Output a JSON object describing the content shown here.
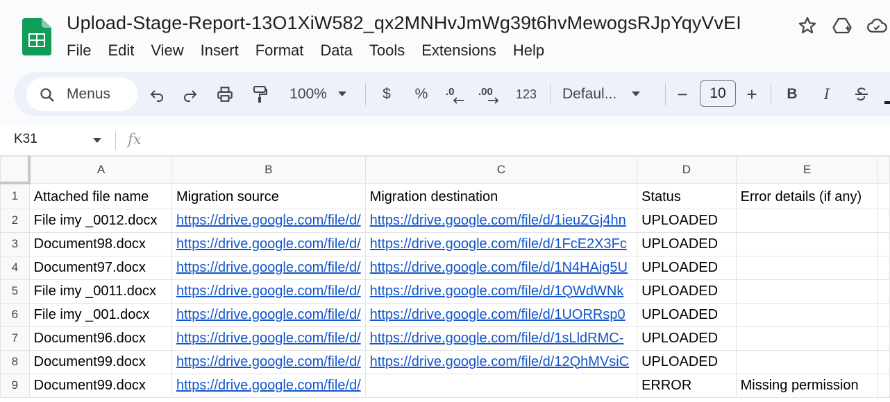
{
  "document": {
    "title": "Upload-Stage-Report-13O1XiW582_qx2MNHvJmWg39t6hvMewogsRJpYqyVvEI"
  },
  "menu": [
    "File",
    "Edit",
    "View",
    "Insert",
    "Format",
    "Data",
    "Tools",
    "Extensions",
    "Help"
  ],
  "toolbar": {
    "search_label": "Menus",
    "zoom": "100%",
    "currency": "$",
    "percent": "%",
    "number_format": "123",
    "font_name": "Defaul...",
    "font_size": "10",
    "minus": "−",
    "plus": "+",
    "bold": "B",
    "italic": "I"
  },
  "formula_bar": {
    "cell_ref": "K31",
    "fx": "fx"
  },
  "sheet": {
    "columns": [
      "A",
      "B",
      "C",
      "D",
      "E"
    ],
    "rows": [
      {
        "num": "1",
        "a": "Attached file name",
        "b": "Migration source",
        "c": "Migration destination",
        "d": "Status",
        "e": "Error details (if any)"
      },
      {
        "num": "2",
        "a": "File imy _0012.docx",
        "b": "https://drive.google.com/file/d/",
        "c": "https://drive.google.com/file/d/1ieuZGj4hn",
        "d": "UPLOADED",
        "e": ""
      },
      {
        "num": "3",
        "a": "Document98.docx",
        "b": "https://drive.google.com/file/d/",
        "c": "https://drive.google.com/file/d/1FcE2X3Fc",
        "d": "UPLOADED",
        "e": ""
      },
      {
        "num": "4",
        "a": "Document97.docx",
        "b": "https://drive.google.com/file/d/",
        "c": "https://drive.google.com/file/d/1N4HAig5U",
        "d": "UPLOADED",
        "e": ""
      },
      {
        "num": "5",
        "a": "File imy _0011.docx",
        "b": "https://drive.google.com/file/d/",
        "c": "https://drive.google.com/file/d/1QWdWNk",
        "d": "UPLOADED",
        "e": ""
      },
      {
        "num": "6",
        "a": "File imy _001.docx",
        "b": "https://drive.google.com/file/d/",
        "c": "https://drive.google.com/file/d/1UORRsp0",
        "d": "UPLOADED",
        "e": ""
      },
      {
        "num": "7",
        "a": "Document96.docx",
        "b": "https://drive.google.com/file/d/",
        "c": "https://drive.google.com/file/d/1sLldRMC-",
        "d": "UPLOADED",
        "e": ""
      },
      {
        "num": "8",
        "a": "Document99.docx",
        "b": "https://drive.google.com/file/d/",
        "c": "https://drive.google.com/file/d/12QhMVsiC",
        "d": "UPLOADED",
        "e": ""
      },
      {
        "num": "9",
        "a": "Document99.docx",
        "b": "https://drive.google.com/file/d/",
        "c": "",
        "d": "ERROR",
        "e": "Missing permission"
      }
    ]
  },
  "colors": {
    "link": "#1155cc",
    "sheets_green": "#0f9d58",
    "toolbar_bg": "#edf2fa"
  }
}
